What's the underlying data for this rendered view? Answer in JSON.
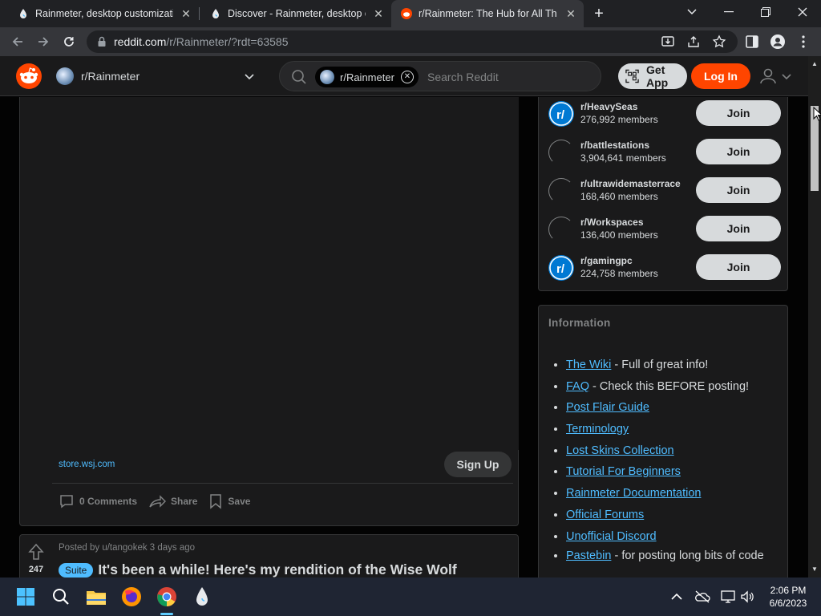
{
  "browser": {
    "tabs": [
      {
        "title": "Rainmeter, desktop customization",
        "active": false
      },
      {
        "title": "Discover - Rainmeter, desktop customization",
        "active": false
      },
      {
        "title": "r/Rainmeter: The Hub for All Things Rainmeter",
        "active": true
      }
    ],
    "url": {
      "host": "reddit.com",
      "path": "/r/Rainmeter/?rdt=63585"
    }
  },
  "header": {
    "community": "r/Rainmeter",
    "search_chip": "r/Rainmeter",
    "search_placeholder": "Search Reddit",
    "get_app_label": "Get App",
    "login_label": "Log In"
  },
  "post_ad": {
    "link_text": "store.wsj.com",
    "signup_label": "Sign Up",
    "actions": {
      "comments": "0 Comments",
      "share": "Share",
      "save": "Save"
    }
  },
  "post2": {
    "votes": "247",
    "meta": "Posted by u/tangokek 3 days ago",
    "flair": "Suite",
    "title": "It's been a while! Here's my rendition of the Wise Wolf"
  },
  "sidebar": {
    "communities": [
      {
        "name": "r/HeavySeas",
        "members": "276,992 members",
        "icon": "reddit"
      },
      {
        "name": "r/battlestations",
        "members": "3,904,641 members",
        "icon": "broken"
      },
      {
        "name": "r/ultrawidemasterrace",
        "members": "168,460 members",
        "icon": "broken"
      },
      {
        "name": "r/Workspaces",
        "members": "136,400 members",
        "icon": "broken"
      },
      {
        "name": "r/gamingpc",
        "members": "224,758 members",
        "icon": "reddit"
      }
    ],
    "join_label": "Join",
    "info": {
      "title": "Information",
      "items": [
        {
          "link": "The Wiki",
          "text": " - Full of great info!"
        },
        {
          "link": "FAQ",
          "text": " - Check this BEFORE posting!"
        },
        {
          "link": "Post Flair Guide",
          "text": ""
        },
        {
          "link": "Terminology",
          "text": ""
        },
        {
          "link": "Lost Skins Collection",
          "text": ""
        },
        {
          "link": "Tutorial For Beginners",
          "text": ""
        },
        {
          "link": "Rainmeter Documentation",
          "text": ""
        },
        {
          "link": "Official Forums",
          "text": ""
        },
        {
          "link": "Unofficial Discord",
          "text": ""
        },
        {
          "link": "Pastebin",
          "text": " - for posting long bits of code"
        }
      ]
    }
  },
  "taskbar": {
    "time": "2:06 PM",
    "date": "6/6/2023"
  },
  "colors": {
    "reddit_orange": "#ff4500",
    "link_blue": "#4fbcff",
    "card_bg": "#1a1a1b",
    "page_bg": "#030303"
  }
}
